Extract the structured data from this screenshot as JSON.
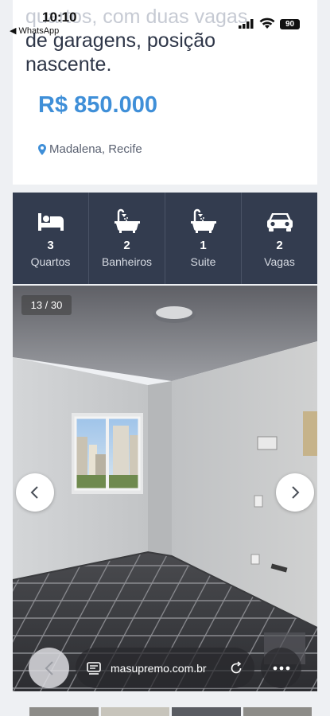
{
  "status_bar": {
    "time": "10:10",
    "back_app": "◀ WhatsApp",
    "battery": "90"
  },
  "listing": {
    "description_faded": "...o, com duas vagas",
    "description_line1": "quartos, com duas vagas",
    "description_line2": "de garagens, posição",
    "description_line3": "nascente.",
    "price": "R$ 850.000",
    "location": "Madalena, Recife"
  },
  "features": [
    {
      "icon": "bed-icon",
      "count": "3",
      "label": "Quartos"
    },
    {
      "icon": "bathtub-icon",
      "count": "2",
      "label": "Banheiros"
    },
    {
      "icon": "bathtub-icon",
      "count": "1",
      "label": "Suite"
    },
    {
      "icon": "car-icon",
      "count": "2",
      "label": "Vagas"
    }
  ],
  "gallery": {
    "counter": "13 / 30"
  },
  "browser": {
    "url": "masupremo.com.br"
  },
  "colors": {
    "accent": "#3f8fd8",
    "feature_bg": "#333c4f"
  }
}
